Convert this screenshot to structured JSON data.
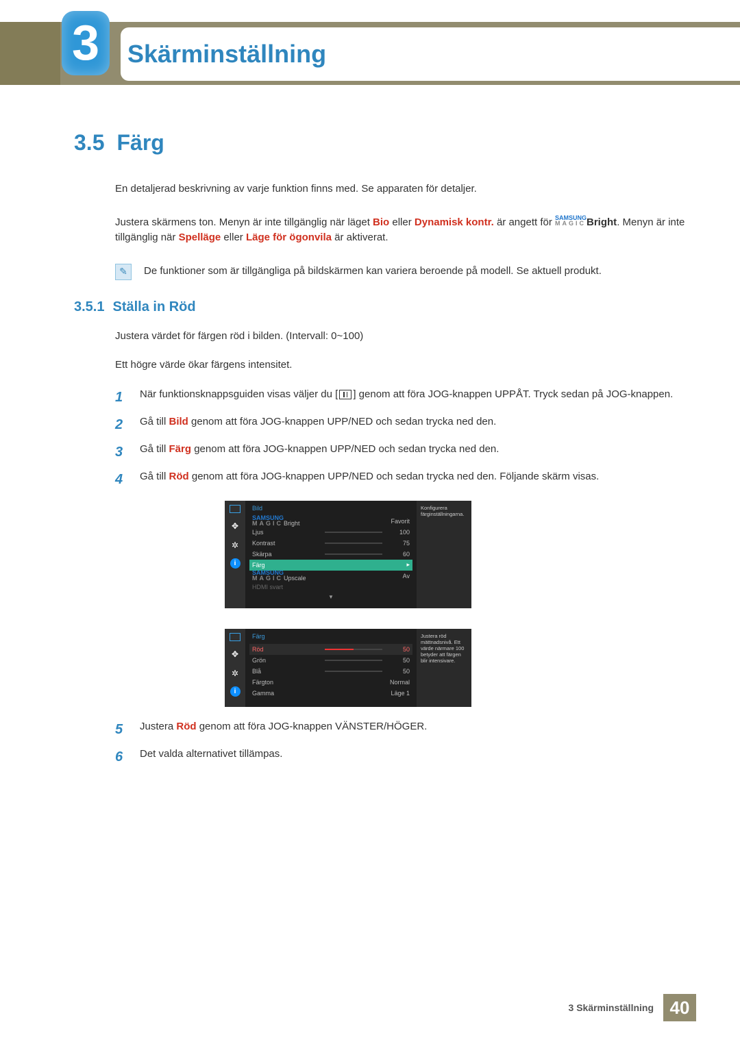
{
  "chapter": {
    "num": "3",
    "title": "Skärminställning"
  },
  "section": {
    "num": "3.5",
    "title": "Färg"
  },
  "intro": {
    "p1": "En detaljerad beskrivning av varje funktion finns med. Se apparaten för detaljer.",
    "p2_a": "Justera skärmens ton. Menyn är inte tillgänglig när läget ",
    "p2_b": "Bio",
    "p2_c": " eller ",
    "p2_d": "Dynamisk kontr.",
    "p2_e": " är angett för ",
    "p2_f": "Bright",
    "p2_g": ". Menyn är inte tillgänglig när ",
    "p2_h": "Spelläge",
    "p2_i": " eller ",
    "p2_j": "Läge för ögonvila",
    "p2_k": " är aktiverat."
  },
  "magic": {
    "l1": "SAMSUNG",
    "l2": "MAGIC"
  },
  "note": "De funktioner som är tillgängliga på bildskärmen kan variera beroende på modell. Se aktuell produkt.",
  "sub": {
    "num": "3.5.1",
    "title": "Ställa in Röd"
  },
  "sub_p1": "Justera värdet för färgen röd i bilden. (Intervall: 0~100)",
  "sub_p2": "Ett högre värde ökar färgens intensitet.",
  "steps": {
    "s1a": "När funktionsknappsguiden visas väljer du [",
    "s1b": "] genom att föra JOG-knappen UPPÅT. Tryck sedan på JOG-knappen.",
    "s2a": "Gå till ",
    "s2b": "Bild",
    "s2c": " genom att föra JOG-knappen UPP/NED och sedan trycka ned den.",
    "s3a": "Gå till ",
    "s3b": "Färg",
    "s3c": " genom att föra JOG-knappen UPP/NED och sedan trycka ned den.",
    "s4a": "Gå till ",
    "s4b": "Röd",
    "s4c": " genom att föra JOG-knappen UPP/NED och sedan trycka ned den. Följande skärm visas.",
    "s5a": "Justera ",
    "s5b": "Röd",
    "s5c": " genom att föra JOG-knappen VÄNSTER/HÖGER.",
    "s6": "Det valda alternativet tillämpas."
  },
  "nums": {
    "n1": "1",
    "n2": "2",
    "n3": "3",
    "n4": "4",
    "n5": "5",
    "n6": "6"
  },
  "osd1": {
    "title": "Bild",
    "help": "Konfigurera färginställningarna.",
    "r1": {
      "l": "Bright",
      "v": "Favorit"
    },
    "r2": {
      "l": "Ljus",
      "v": "100"
    },
    "r3": {
      "l": "Kontrast",
      "v": "75"
    },
    "r4": {
      "l": "Skärpa",
      "v": "60"
    },
    "r5": {
      "l": "Färg"
    },
    "r6": {
      "l": "Upscale",
      "v": "Av"
    },
    "r7": {
      "l": "HDMI svart"
    },
    "down": "▼"
  },
  "osd2": {
    "title": "Färg",
    "help": "Justera röd mättnadsnivå. Ett värde närmare 100 betyder att färgen blir intensivare.",
    "r1": {
      "l": "Röd",
      "v": "50"
    },
    "r2": {
      "l": "Grön",
      "v": "50"
    },
    "r3": {
      "l": "Blå",
      "v": "50"
    },
    "r4": {
      "l": "Färgton",
      "v": "Normal"
    },
    "r5": {
      "l": "Gamma",
      "v": "Läge 1"
    }
  },
  "footer": {
    "label": "3 Skärminställning",
    "page": "40"
  },
  "icons": {
    "monitor": "monitor",
    "arrows": "arrows",
    "gear": "gear",
    "info": "i",
    "note": "✎"
  }
}
